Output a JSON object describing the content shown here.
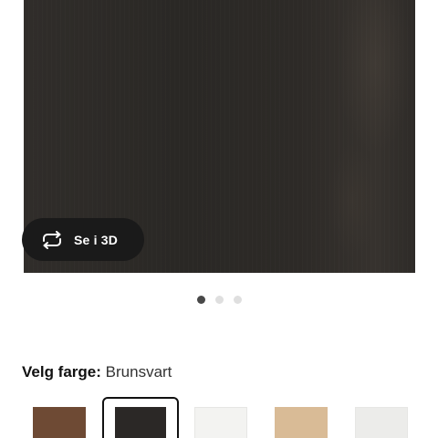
{
  "product": {
    "view_3d_label": "Se i 3D",
    "carousel": {
      "total": 3,
      "active_index": 0
    }
  },
  "color_picker": {
    "label": "Velg farge:",
    "selected_value": "Brunsvart",
    "swatches": [
      {
        "color": "#6e4a34",
        "selected": false
      },
      {
        "color": "#2b2826",
        "selected": true
      },
      {
        "color": "#f3f3f1",
        "selected": false
      },
      {
        "color": "#d9bb96",
        "selected": false
      },
      {
        "color": "#ececea",
        "selected": false
      }
    ]
  },
  "icons": {
    "view_3d": "rotate-3d-icon"
  },
  "colors": {
    "button_bg": "#1a1a1a",
    "dot_active": "#484848",
    "dot_inactive": "#dfdfdf"
  }
}
